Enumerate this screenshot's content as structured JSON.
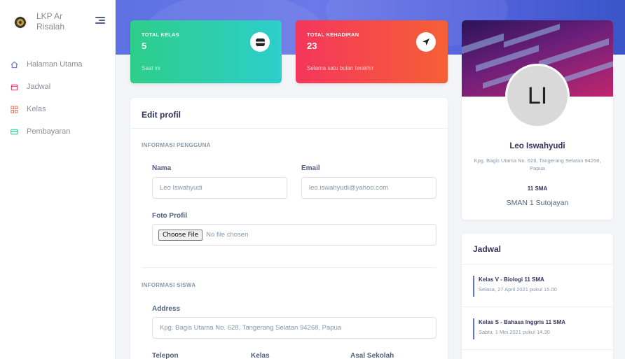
{
  "brand": {
    "name": "LKP Ar Risalah"
  },
  "sidebar": {
    "items": [
      {
        "label": "Halaman Utama",
        "icon": "home-icon",
        "color": "#5e72e4"
      },
      {
        "label": "Jadwal",
        "icon": "calendar-icon",
        "color": "#f5365c"
      },
      {
        "label": "Kelas",
        "icon": "grid-icon",
        "color": "#fb6340"
      },
      {
        "label": "Pembayaran",
        "icon": "credit-card-icon",
        "color": "#2dce89"
      }
    ]
  },
  "stats": [
    {
      "title": "TOTAL KELAS",
      "value": "5",
      "footnote": "Saat ini",
      "icon": "wallet-icon",
      "color": "#2dce89"
    },
    {
      "title": "TOTAL KEHADIRAN",
      "value": "23",
      "footnote": "Selama satu bulan terakhir",
      "icon": "location-arrow-icon",
      "color": "#f5365c"
    }
  ],
  "edit_profile": {
    "title": "Edit profil",
    "section_user": "INFORMASI PENGGUNA",
    "name_label": "Nama",
    "name_value": "Leo Iswahyudi",
    "email_label": "Email",
    "email_value": "leo.iswahyudi@yahoo.com",
    "photo_label": "Foto Profil",
    "file_button": "Choose File",
    "file_status": "No file chosen",
    "section_student": "INFORMASI SISWA",
    "address_label": "Address",
    "address_value": "Kpg. Bagis Utama No. 628, Tangerang Selatan 94268, Papua",
    "phone_label": "Telepon",
    "class_label": "Kelas",
    "school_label": "Asal Sekolah"
  },
  "profile": {
    "initials": "LI",
    "name": "Leo Iswahyudi",
    "address": "Kpg. Bagis Utama No. 628, Tangerang Selatan 94268, Papua",
    "class": "11 SMA",
    "school": "SMAN 1 Sutojayan"
  },
  "schedule": {
    "title": "Jadwal",
    "items": [
      {
        "title": "Kelas V - Biologi 11 SMA",
        "time": "Selasa, 27 April 2021 pukul 15.00"
      },
      {
        "title": "Kelas S - Bahasa Inggris 11 SMA",
        "time": "Sabtu, 1 Mei 2021 pukul 14.30"
      }
    ]
  }
}
